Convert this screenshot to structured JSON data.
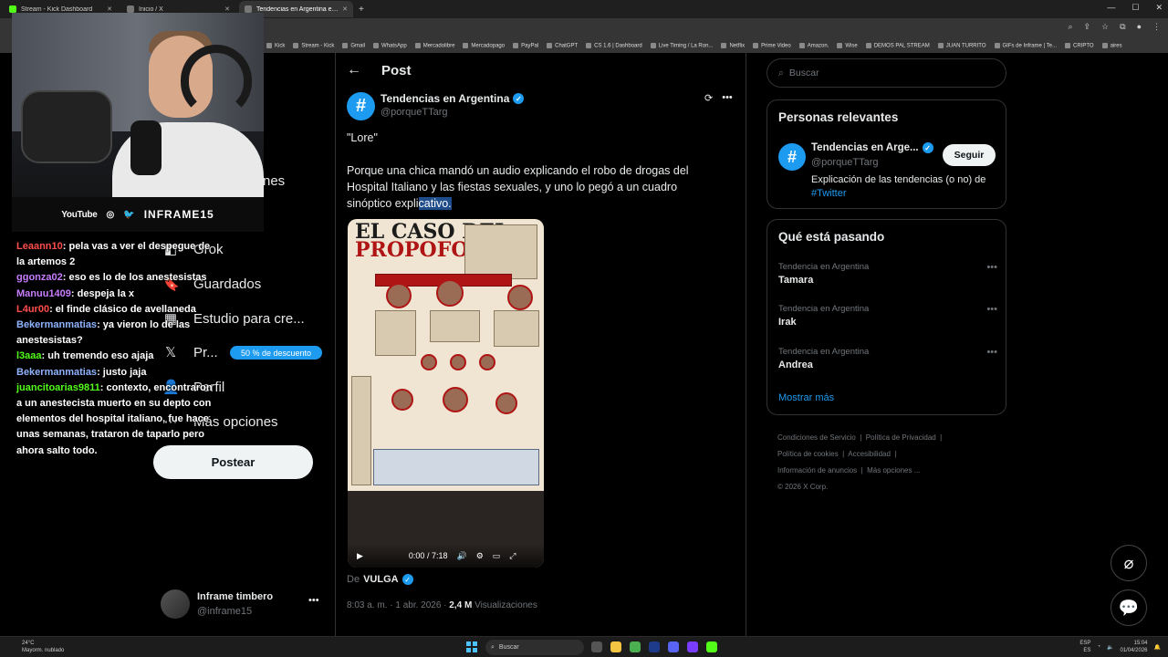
{
  "browser": {
    "tabs": [
      {
        "label": "Stream - Kick Dashboard",
        "color": "#53fc18"
      },
      {
        "label": "Inicio / X",
        "color": "#ffffff"
      },
      {
        "label": "Tendencias en Argentina en X",
        "color": "#ffffff"
      }
    ],
    "active_tab": 2,
    "bookmarks": [
      "Kick",
      "Stream - Kick",
      "Gmail",
      "WhatsApp",
      "Mercadolibre",
      "Mercadopago",
      "PayPal",
      "ChatGPT",
      "CS 1.6 | Dashboard",
      "Live Timing / La Ron...",
      "Netflix",
      "Prime Video",
      "Amazon.",
      "Wise",
      "DEMOS PAL STREAM",
      "JUAN TURRITO",
      "GIFs de Inframe | Te...",
      "CRIPTO",
      "aires"
    ]
  },
  "stream": {
    "social_youtube": "YouTube",
    "channel": "INFRAME15",
    "chat": [
      {
        "user": "Leaann10",
        "color": "#ff4d4d",
        "msg": ": pela vas a ver el despegue de la artemos 2"
      },
      {
        "user": "ggonza02",
        "color": "#c77dff",
        "msg": ": eso es lo de los anestesistas"
      },
      {
        "user": "Manuu1409",
        "color": "#c77dff",
        "msg": ": despeja la x"
      },
      {
        "user": "L4ur00",
        "color": "#ff4d4d",
        "msg": ": el finde clásico de avellaneda"
      },
      {
        "user": "Bekermanmatias",
        "color": "#8fb3ff",
        "msg": ": ya vieron lo de las anestesistas?"
      },
      {
        "user": "l3aaa",
        "color": "#53fc18",
        "msg": ": uh tremendo eso ajaja"
      },
      {
        "user": "Bekermanmatias",
        "color": "#8fb3ff",
        "msg": ": justo jaja"
      },
      {
        "user": "juancitoarias9811",
        "color": "#53fc18",
        "msg": ": contexto, encontraron a un anestecista muerto en su depto con elementos del hospital italiano, fue hace unas semanas, trataron de taparlo pero ahora salto todo."
      }
    ]
  },
  "nav": {
    "items": [
      {
        "label": "nes",
        "icon": "notifications-icon"
      },
      {
        "label": "Grok",
        "icon": "grok-icon"
      },
      {
        "label": "Guardados",
        "icon": "bookmark-icon"
      },
      {
        "label": "Estudio para cre...",
        "icon": "studio-icon"
      },
      {
        "label": "Pr...",
        "icon": "x-logo-icon"
      },
      {
        "label": "Perfil",
        "icon": "person-icon"
      },
      {
        "label": "Más opciones",
        "icon": "more-icon"
      }
    ],
    "promo": "50 % de descuento",
    "post_button": "Postear",
    "account_name": "Inframe timbero",
    "account_handle": "@inframe15"
  },
  "post": {
    "header": "Post",
    "author": "Tendencias en Argentina",
    "handle": "@porqueTTarg",
    "line1": "\"Lore\"",
    "body_a": "Porque una chica mandó un audio explicando el robo de drogas del Hospital Italiano y las fiestas sexuales, y uno lo pegó a un cuadro sinóptico expli",
    "body_b": "cativo.",
    "media_title_1": "EL CASO DEL",
    "media_title_2": "PROPOFOL",
    "video_time": "0:00 / 7:18",
    "source_prefix": "De",
    "source_name": "VULGA",
    "timestamp": "8:03 a. m. · 1 abr. 2026 · ",
    "views": "2,4 M",
    "views_label": " Visualizaciones"
  },
  "sidebar": {
    "search_placeholder": "Buscar",
    "relevant_title": "Personas relevantes",
    "relevant_name": "Tendencias en Arge...",
    "relevant_handle": "@porqueTTarg",
    "follow": "Seguir",
    "bio": "Explicación de las tendencias (o no) de ",
    "bio_tag": "#Twitter",
    "happening_title": "Qué está pasando",
    "trends": [
      {
        "context": "Tendencia en Argentina",
        "title": "Tamara"
      },
      {
        "context": "Tendencia en Argentina",
        "title": "Irak"
      },
      {
        "context": "Tendencia en Argentina",
        "title": "Andrea"
      }
    ],
    "show_more": "Mostrar más",
    "footer": [
      "Condiciones de Servicio",
      "Política de Privacidad",
      "Política de cookies",
      "Accesibilidad",
      "Información de anuncios",
      "Más opciones ...",
      "© 2026 X Corp."
    ]
  },
  "taskbar": {
    "temp": "24°C",
    "weather": "Mayorm. nublado",
    "search": "Buscar",
    "lang": "ESP",
    "lang2": "ES",
    "time": "15:04",
    "date": "01/04/2026"
  },
  "colors": {
    "accent": "#1d9bf0",
    "bg": "#000000",
    "border": "#2f3336",
    "muted": "#71767b"
  }
}
